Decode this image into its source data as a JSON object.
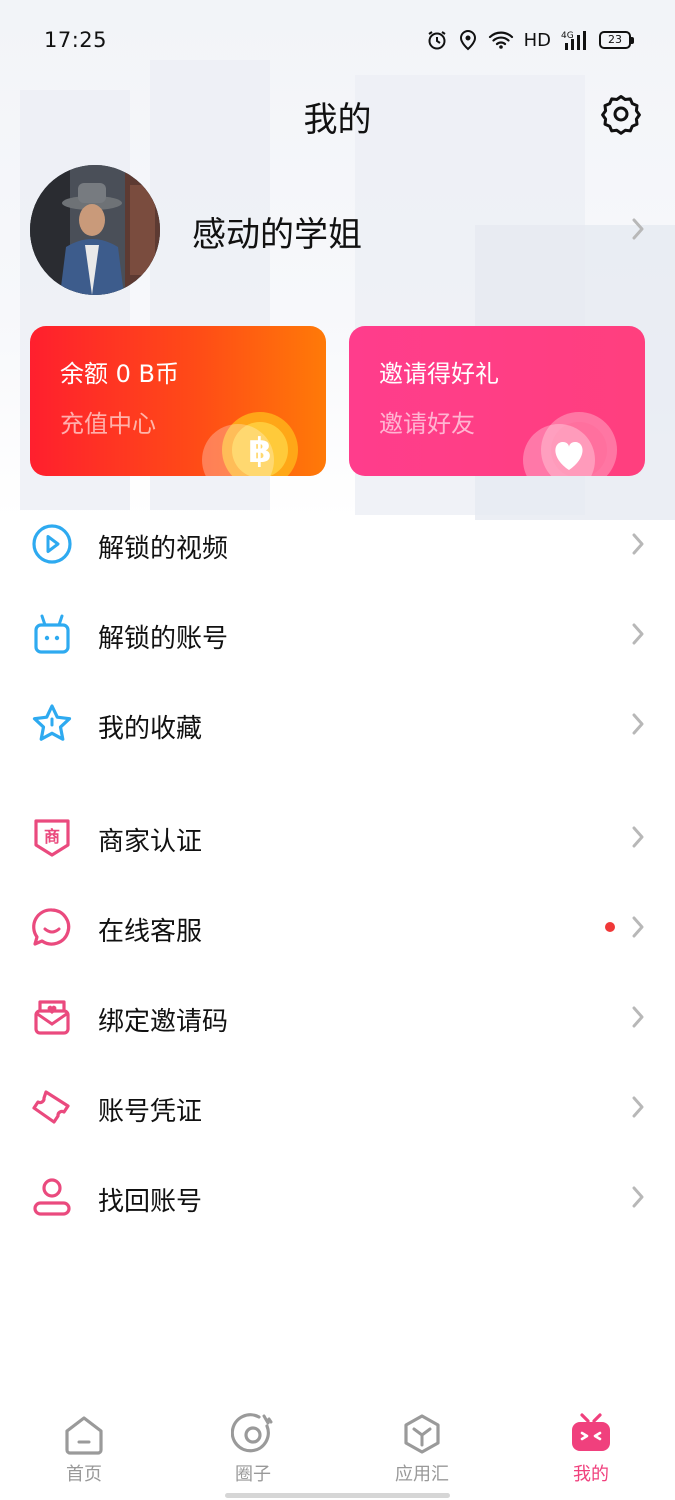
{
  "status_bar": {
    "time": "17:25",
    "network": "HD",
    "signal_type": "4G",
    "battery": "23"
  },
  "header": {
    "title": "我的",
    "settings_icon": "gear-icon"
  },
  "profile": {
    "username": "感动的学姐"
  },
  "cards": {
    "balance": {
      "title": "余额 0 B币",
      "subtitle": "充值中心",
      "icon": "coin-icon"
    },
    "invite": {
      "title": "邀请得好礼",
      "subtitle": "邀请好友",
      "icon": "heart-icon"
    }
  },
  "menu": [
    {
      "label": "解锁的视频",
      "icon": "play-circle-icon"
    },
    {
      "label": "解锁的账号",
      "icon": "bag-icon"
    },
    {
      "label": "我的收藏",
      "icon": "star-icon"
    },
    {
      "label": "商家认证",
      "icon": "merchant-badge-icon",
      "icon_text": "商"
    },
    {
      "label": "在线客服",
      "icon": "chat-icon",
      "badge": "red-dot"
    },
    {
      "label": "绑定邀请码",
      "icon": "envelope-icon"
    },
    {
      "label": "账号凭证",
      "icon": "ticket-icon"
    },
    {
      "label": "找回账号",
      "icon": "user-icon"
    }
  ],
  "tabbar": {
    "items": [
      {
        "label": "首页",
        "icon": "home-icon"
      },
      {
        "label": "圈子",
        "icon": "circle-icon"
      },
      {
        "label": "应用汇",
        "icon": "cube-icon"
      },
      {
        "label": "我的",
        "icon": "tv-face-icon",
        "active": true
      }
    ]
  },
  "colors": {
    "accent_pink": "#f0407d",
    "balance_card_start": "#ff1f2e",
    "balance_card_end": "#ff7a08",
    "invite_card": "#ff3d8c",
    "menu_icon_blue": "#2eaaf0",
    "menu_icon_pink": "#ea4a7e",
    "chevron": "#b8b8b8",
    "badge_red": "#f03838"
  }
}
